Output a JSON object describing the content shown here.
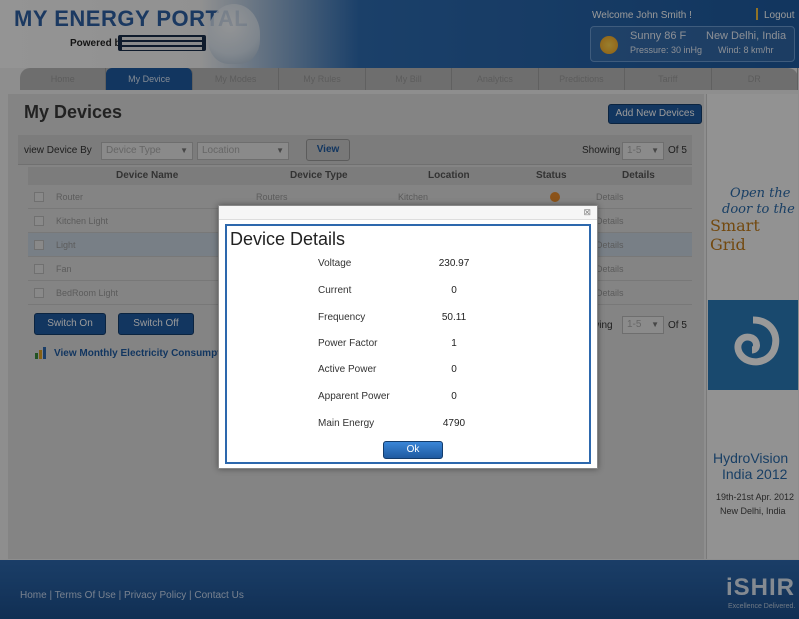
{
  "header": {
    "title": "MY ENERGY PORTAL",
    "powered_by": "Powered by",
    "welcome": "Welcome John Smith !",
    "logout": "Logout",
    "weather": {
      "condition": "Sunny 86 F",
      "pressure": "Pressure: 30 inHg",
      "city": "New Delhi, India",
      "wind": "Wind: 8 km/hr"
    }
  },
  "nav": {
    "tabs": [
      {
        "label": "Home"
      },
      {
        "label": "My Device",
        "active": true
      },
      {
        "label": "My Modes"
      },
      {
        "label": "My Rules"
      },
      {
        "label": "My Bill"
      },
      {
        "label": "Analytics"
      },
      {
        "label": "Predictions"
      },
      {
        "label": "Tariff"
      },
      {
        "label": "DR"
      }
    ]
  },
  "main": {
    "title": "My Devices",
    "add_button": "Add New Devices",
    "filter": {
      "view_by_label": "view Device By",
      "device_type_placeholder": "Device Type",
      "location_placeholder": "Location",
      "view_button": "View",
      "showing_label": "Showing",
      "range": "1-5",
      "of_label": "Of 5"
    },
    "table": {
      "headers": [
        "Device Name",
        "Device Type",
        "Location",
        "Status",
        "Details"
      ],
      "rows": [
        {
          "name": "Router",
          "type": "Routers",
          "location": "Kitchen",
          "status": "on",
          "details": "Details"
        },
        {
          "name": "Kitchen Light",
          "type": "",
          "location": "",
          "status": "",
          "details": "Details"
        },
        {
          "name": "Light",
          "type": "",
          "location": "",
          "status": "",
          "details": "Details",
          "selected": true
        },
        {
          "name": "Fan",
          "type": "",
          "location": "",
          "status": "",
          "details": "Details"
        },
        {
          "name": "BedRoom Light",
          "type": "",
          "location": "",
          "status": "",
          "details": "Details"
        }
      ]
    },
    "switch_on": "Switch On",
    "switch_off": "Switch Off",
    "monthly_link": "View Monthly Electricity Consumption"
  },
  "ad": {
    "line1": "Open the",
    "line2": "door to the",
    "line3": "Smart Grid",
    "event1": "HydroVision",
    "event2": "India 2012",
    "date": "19th-21st Apr. 2012",
    "city": "New Delhi, India"
  },
  "footer": {
    "links": [
      "Home",
      "Terms Of Use",
      "Privacy Policy",
      "Contact Us"
    ],
    "brand": "iSHIR",
    "tagline": "Excellence Delivered."
  },
  "modal": {
    "title": "Device Details",
    "fields": [
      {
        "label": "Voltage",
        "value": "230.97"
      },
      {
        "label": "Current",
        "value": "0"
      },
      {
        "label": "Frequency",
        "value": "50.11"
      },
      {
        "label": "Power Factor",
        "value": "1"
      },
      {
        "label": "Active Power",
        "value": "0"
      },
      {
        "label": "Apparent Power",
        "value": "0"
      },
      {
        "label": "Main Energy",
        "value": "4790"
      }
    ],
    "ok_button": "Ok",
    "close_glyph": "⊠"
  },
  "colors": {
    "primary_blue": "#1f5aa0",
    "modal_border": "#2d68ad",
    "status_on": "#e88a2a"
  }
}
